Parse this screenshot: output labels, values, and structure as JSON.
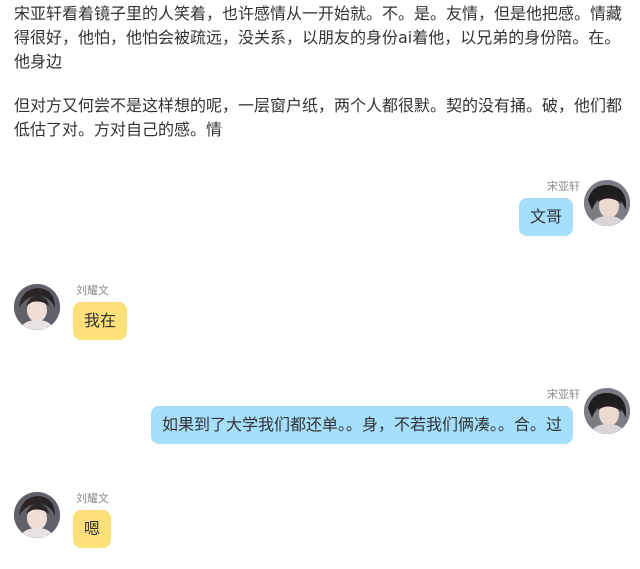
{
  "story": {
    "paragraph1": "宋亚轩看着镜子里的人笑着，也许感情从一开始就。不。是。友情，但是他把感。情藏得很好，他怕，他怕会被疏远，没关系，以朋友的身份ai着他，以兄弟的身份陪。在。他身边",
    "paragraph2": "但对方又何尝不是这样想的呢，一层窗户纸，两个人都很默。契的没有捅。破，他们都低估了对。方对自己的感。情"
  },
  "chat": {
    "messages": [
      {
        "side": "right",
        "sender": "宋亚轩",
        "text": "文哥",
        "bubble_color": "#a6dffb"
      },
      {
        "side": "left",
        "sender": "刘耀文",
        "text": "我在",
        "bubble_color": "#fde07a"
      },
      {
        "side": "right",
        "sender": "宋亚轩",
        "text": "如果到了大学我们都还单。。身，不若我们俩凑。。合。过",
        "bubble_color": "#a6dffb"
      },
      {
        "side": "left",
        "sender": "刘耀文",
        "text": "嗯",
        "bubble_color": "#fde07a"
      }
    ]
  }
}
